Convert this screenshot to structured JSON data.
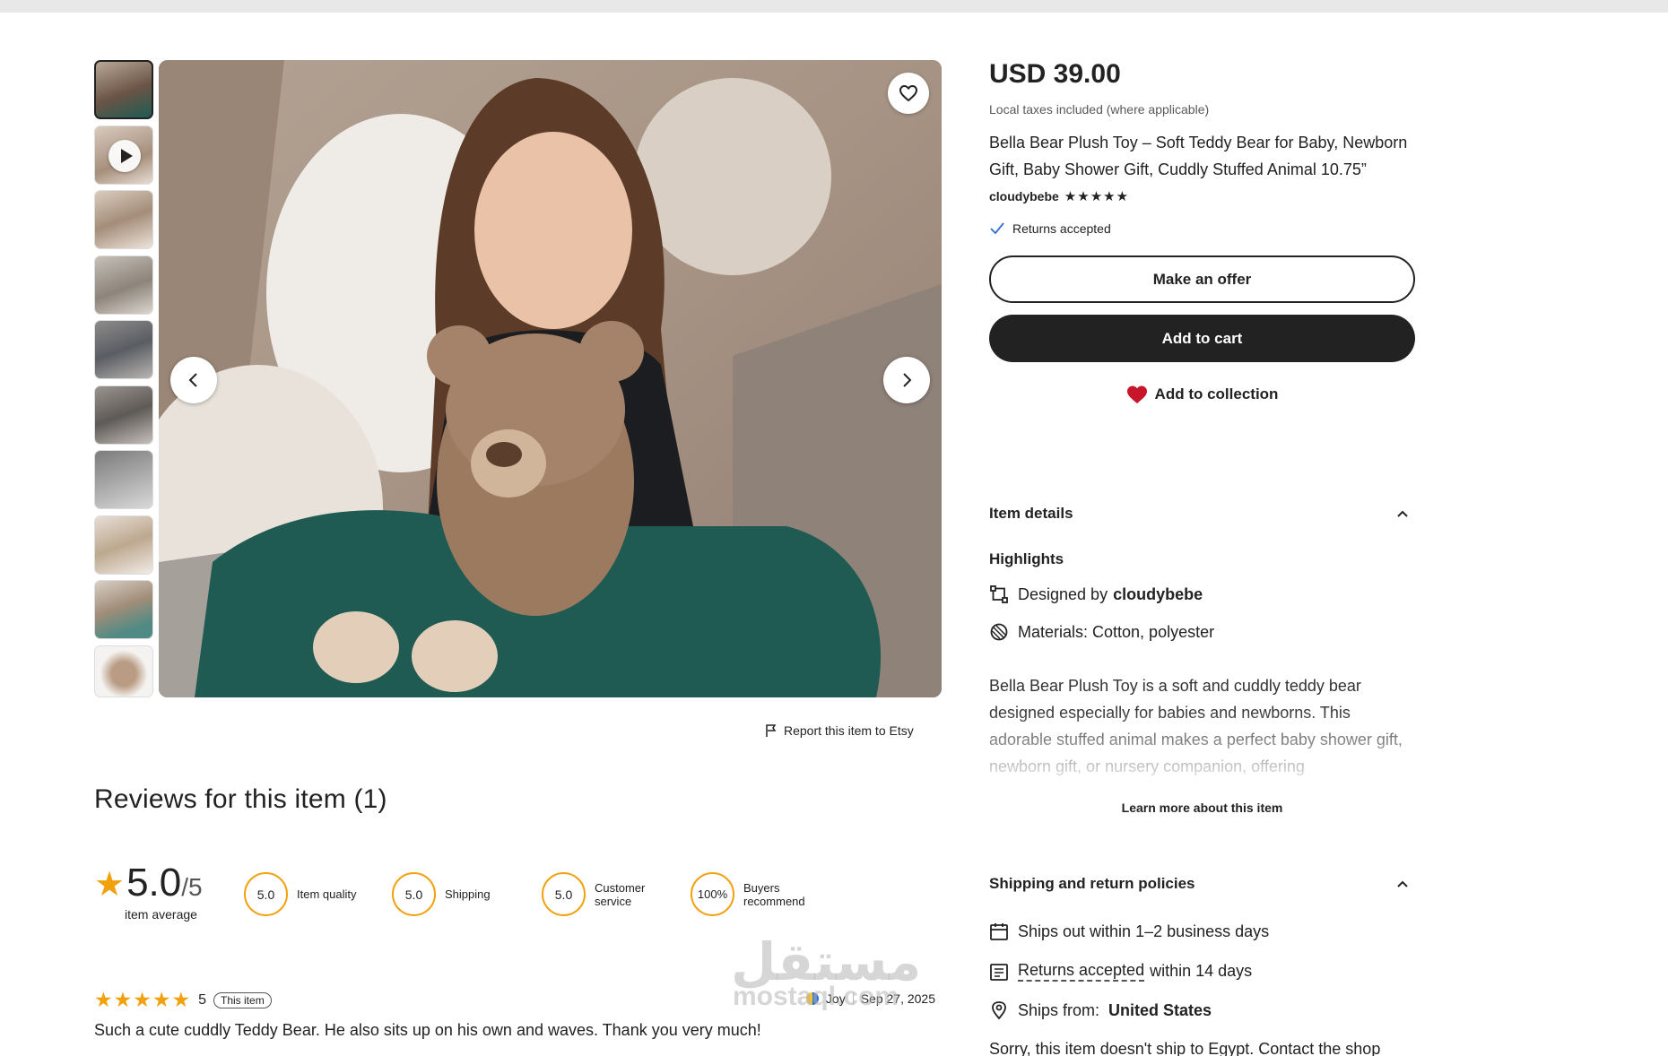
{
  "gallery": {
    "thumbnails": [
      "photo-1",
      "video",
      "photo-3",
      "photo-4",
      "photo-5",
      "photo-6",
      "photo-7",
      "photo-8",
      "photo-9",
      "photo-10"
    ],
    "selected_index": 0
  },
  "report_link": "Report this item to Etsy",
  "reviews": {
    "title": "Reviews for this item (1)",
    "average": "5.0",
    "out_of": "/5",
    "average_label": "item average",
    "metrics": [
      {
        "value": "5.0",
        "label": "Item quality"
      },
      {
        "value": "5.0",
        "label": "Shipping"
      },
      {
        "value": "5.0",
        "label": "Customer service"
      },
      {
        "value": "100%",
        "label": "Buyers recommend"
      }
    ],
    "items": [
      {
        "rating": "5",
        "stars": "★★★★★",
        "badge": "This item",
        "reviewer": "Joy",
        "date": "Sep 27, 2025",
        "text": "Such a cute cuddly Teddy Bear. He also sits up on his own and waves. Thank you very much!"
      }
    ]
  },
  "watermark": {
    "main": "مستقل",
    "sub": "mostaql.com"
  },
  "product": {
    "price": "USD 39.00",
    "tax_note": "Local taxes included (where applicable)",
    "title": "Bella Bear Plush Toy – Soft Teddy Bear for Baby, Newborn Gift, Baby Shower Gift, Cuddly Stuffed Animal 10.75”",
    "shop_name": "cloudybebe",
    "shop_stars": "★★★★★",
    "returns": "Returns accepted",
    "make_offer": "Make an offer",
    "add_to_cart": "Add to cart",
    "add_to_collection": "Add to collection"
  },
  "item_details": {
    "heading": "Item details",
    "highlights_heading": "Highlights",
    "designed_by_label": "Designed by",
    "designed_by_shop": "cloudybebe",
    "materials": "Materials: Cotton, polyester",
    "description": "Bella Bear Plush Toy is a soft and cuddly teddy bear designed especially for babies and newborns. This adorable stuffed animal makes a perfect baby shower gift, newborn gift, or nursery companion, offering",
    "learn_more": "Learn more about this item"
  },
  "shipping": {
    "heading": "Shipping and return policies",
    "ships_out": "Ships out within 1–2 business days",
    "returns_link": "Returns accepted",
    "returns_rest": "within 14 days",
    "ships_from_label": "Ships from:",
    "ships_from_value": "United States",
    "sorry": "Sorry, this item doesn't ship to Egypt. Contact the shop"
  },
  "colors": {
    "star": "#f1a10d",
    "heart": "#c7152a",
    "dark": "#222222"
  }
}
